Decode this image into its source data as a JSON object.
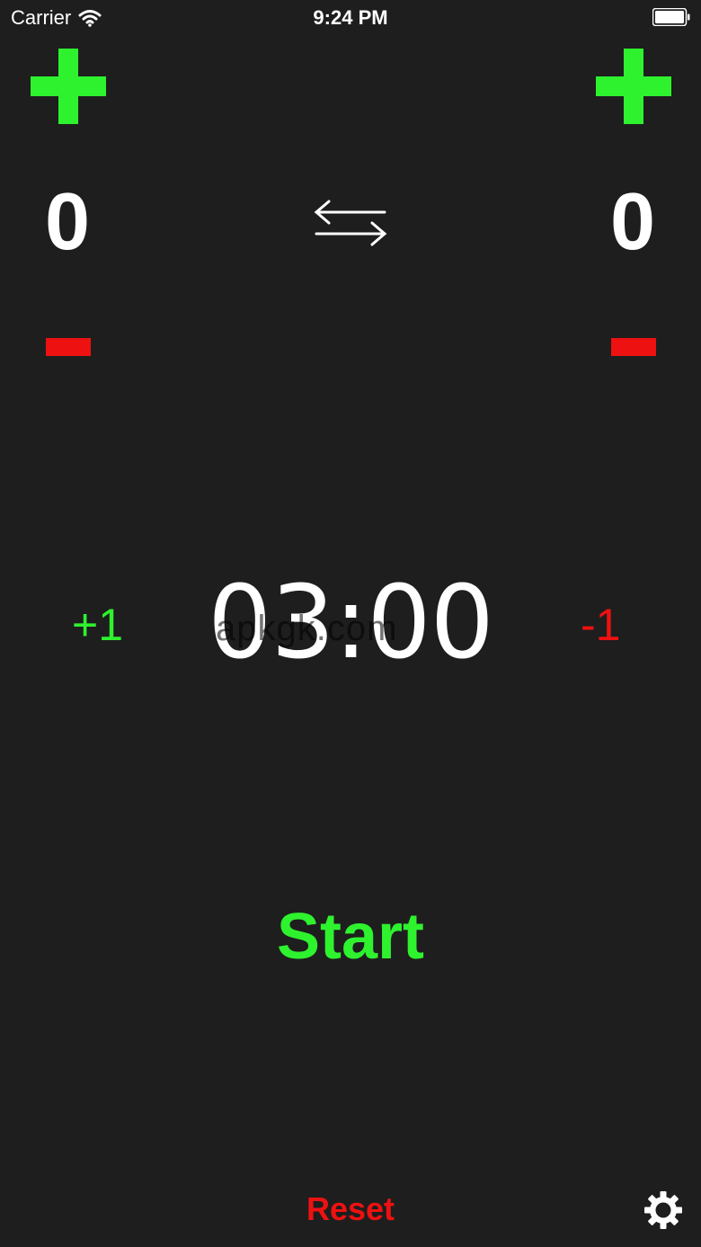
{
  "status_bar": {
    "carrier": "Carrier",
    "time": "9:24 PM",
    "icons": [
      "wifi-icon",
      "battery-icon"
    ]
  },
  "scoreboard": {
    "left": {
      "score": "0",
      "increment_icon": "plus-icon",
      "decrement_icon": "minus-icon"
    },
    "right": {
      "score": "0",
      "increment_icon": "plus-icon",
      "decrement_icon": "minus-icon"
    },
    "swap_icon": "swap-arrows-icon"
  },
  "timer": {
    "display": "03:00",
    "add_label": "+1",
    "subtract_label": "-1",
    "watermark": "apkgk.com"
  },
  "actions": {
    "start_label": "Start",
    "reset_label": "Reset",
    "settings_icon": "gear-icon"
  },
  "colors": {
    "background": "#1e1e1e",
    "accent_green": "#2ef22e",
    "accent_red": "#ee1111",
    "text": "#ffffff"
  }
}
